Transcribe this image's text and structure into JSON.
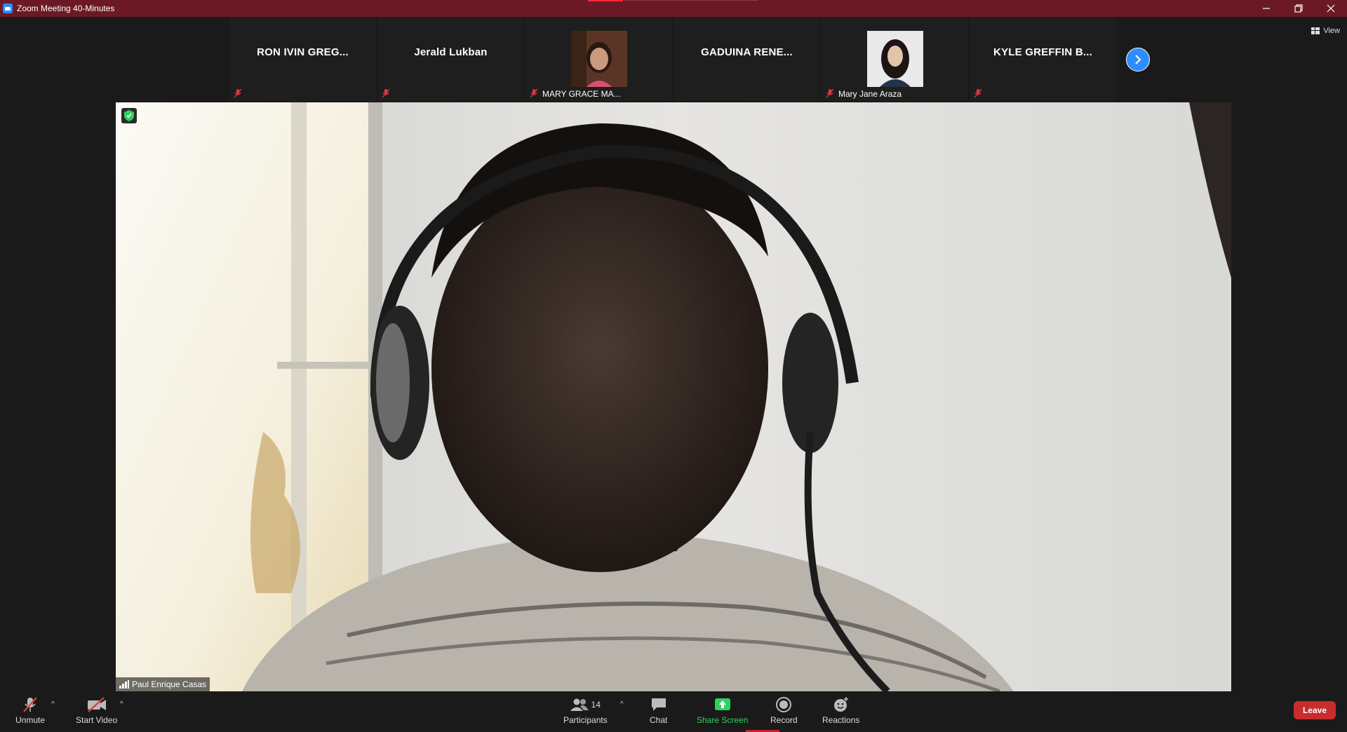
{
  "window": {
    "title": "Zoom Meeting 40-Minutes"
  },
  "strip": {
    "tiles": [
      {
        "name": "RON IVIN GREG...",
        "muted": true
      },
      {
        "name": "Jerald Lukban",
        "muted": true
      },
      {
        "label": "MARY GRACE MA...",
        "muted": true,
        "has_video": true
      },
      {
        "name": "GADUINA RENE...",
        "muted": false
      },
      {
        "label": "Mary Jane Araza",
        "muted": true,
        "has_video": true
      },
      {
        "name": "KYLE GREFFIN B...",
        "muted": true
      }
    ],
    "view_label": "View"
  },
  "main_video": {
    "speaker_name": "Paul Enrique Casas"
  },
  "toolbar": {
    "unmute_label": "Unmute",
    "start_video_label": "Start Video",
    "participants_label": "Participants",
    "participants_count": "14",
    "chat_label": "Chat",
    "share_screen_label": "Share Screen",
    "record_label": "Record",
    "reactions_label": "Reactions",
    "leave_label": "Leave"
  },
  "colors": {
    "titlebar": "#6b1a25",
    "accent_blue": "#2d8cff",
    "share_green": "#2fd25f",
    "leave_red": "#c82c2c",
    "mute_red": "#e0393e"
  }
}
